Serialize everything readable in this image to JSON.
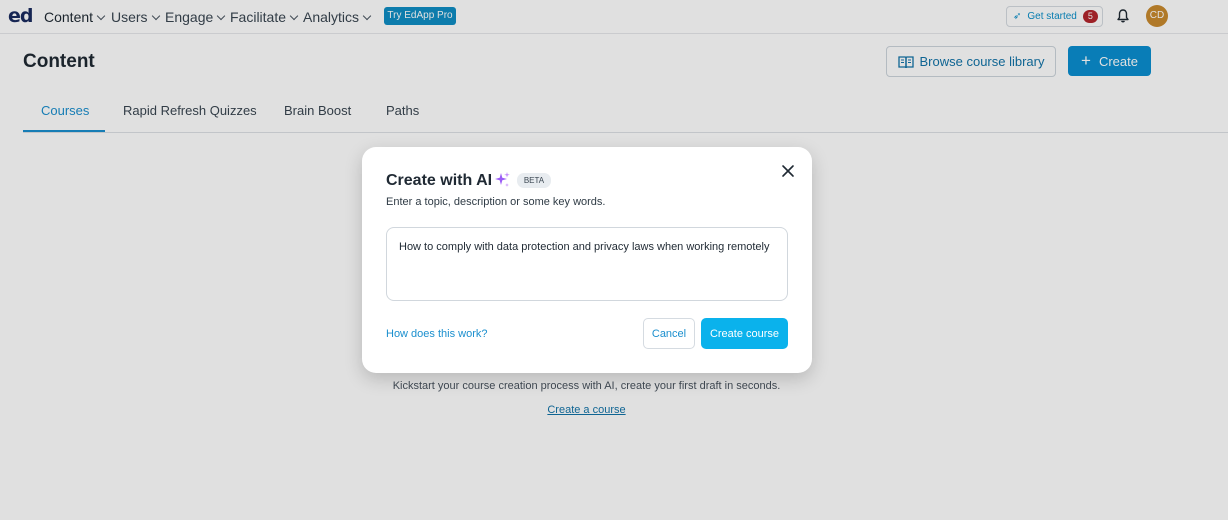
{
  "nav": {
    "logo": "ed",
    "items": [
      {
        "label": "Content"
      },
      {
        "label": "Users"
      },
      {
        "label": "Engage"
      },
      {
        "label": "Facilitate"
      },
      {
        "label": "Analytics"
      }
    ],
    "pro_button": "Try EdApp Pro",
    "get_started": {
      "label": "Get started",
      "count": "5"
    },
    "avatar_initials": "CD"
  },
  "page": {
    "title": "Content",
    "browse_button": "Browse course library",
    "create_button": "Create"
  },
  "tabs": [
    {
      "label": "Courses",
      "active": true
    },
    {
      "label": "Rapid Refresh Quizzes"
    },
    {
      "label": "Brain Boost"
    },
    {
      "label": "Paths"
    }
  ],
  "empty_state": {
    "text": "Kickstart your course creation process with AI, create your first draft in seconds.",
    "link": "Create a course"
  },
  "modal": {
    "title": "Create with AI",
    "badge": "BETA",
    "subtitle": "Enter a topic, description or some key words.",
    "input_value": "How to comply with data protection and privacy laws when working remotely",
    "help_link": "How does this work?",
    "cancel": "Cancel",
    "submit": "Create course"
  },
  "colors": {
    "accent": "#0b8fd1",
    "primary_button": "#0ab2ec",
    "badge_red": "#b3262d",
    "sparkle": "#9b5cf6"
  }
}
